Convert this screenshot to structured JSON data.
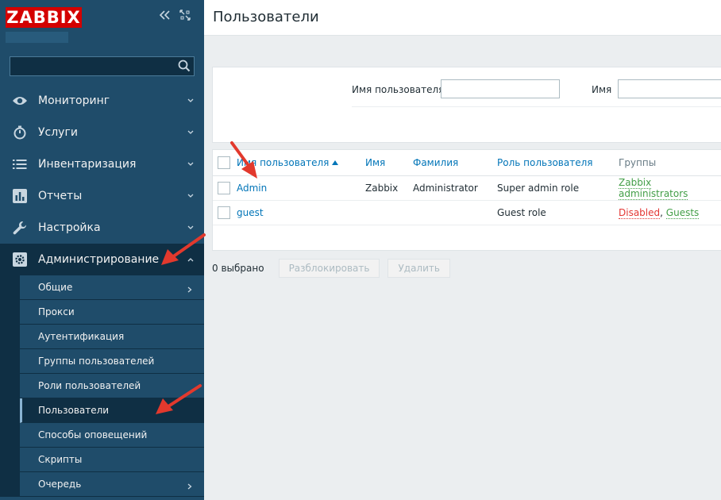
{
  "brand": {
    "logo": "ZABBIX"
  },
  "sidebar": {
    "search_placeholder": "",
    "menu": [
      {
        "label": "Мониторинг",
        "icon": "eye-icon"
      },
      {
        "label": "Услуги",
        "icon": "stopwatch-icon"
      },
      {
        "label": "Инвентаризация",
        "icon": "list-icon"
      },
      {
        "label": "Отчеты",
        "icon": "bar-chart-icon"
      },
      {
        "label": "Настройка",
        "icon": "wrench-icon"
      },
      {
        "label": "Администрирование",
        "icon": "gear-icon"
      }
    ],
    "submenu": [
      "Общие",
      "Прокси",
      "Аутентификация",
      "Группы пользователей",
      "Роли пользователей",
      "Пользователи",
      "Способы оповещений",
      "Скрипты",
      "Очередь"
    ]
  },
  "page": {
    "title": "Пользователи"
  },
  "filter": {
    "username_label": "Имя пользователя",
    "name_label": "Имя"
  },
  "table": {
    "headers": {
      "username": "Имя пользователя",
      "name": "Имя",
      "surname": "Фамилия",
      "role": "Роль пользователя",
      "groups": "Группы"
    },
    "rows": [
      {
        "username": "Admin",
        "name": "Zabbix",
        "surname": "Administrator",
        "role": "Super admin role",
        "groups": [
          "Zabbix administrators"
        ]
      },
      {
        "username": "guest",
        "name": "",
        "surname": "",
        "role": "Guest role",
        "groups_disabled": "Disabled",
        "groups_sep": ",",
        "groups": [
          "Guests"
        ]
      }
    ]
  },
  "actions": {
    "selected": "0 выбрано",
    "unblock": "Разблокировать",
    "delete": "Удалить"
  },
  "colors": {
    "sidebar": "#1f4c6a",
    "sidebar_dark": "#0f2f44",
    "logo": "#d40000",
    "link": "#0275b8",
    "group_link": "#429e47",
    "disabled": "#e33734",
    "annotation_arrow": "#e2392d"
  }
}
